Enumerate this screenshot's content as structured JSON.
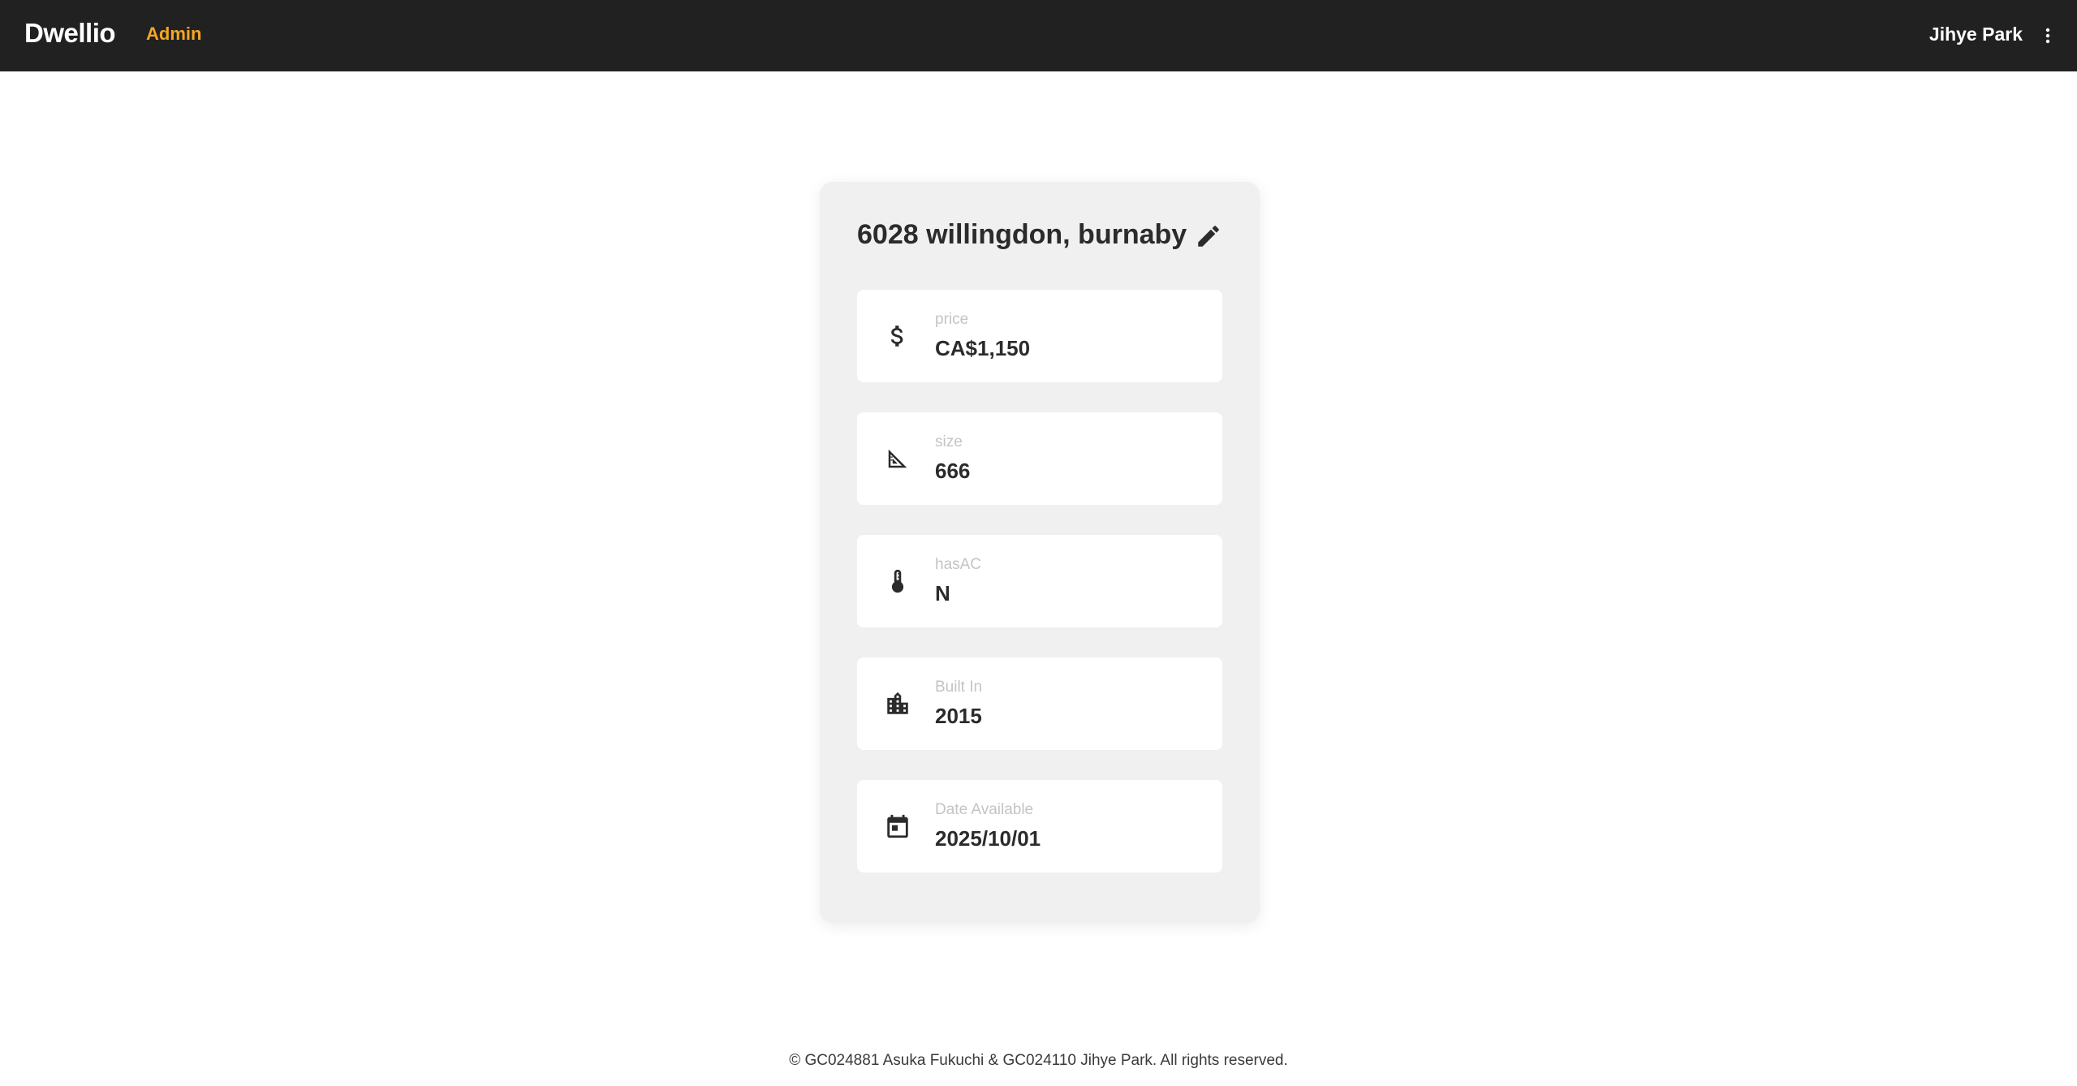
{
  "header": {
    "brand": "Dwellio",
    "role_link": "Admin",
    "user_name": "Jihye Park",
    "menu_icon": "more-vert-icon"
  },
  "listing": {
    "title": "6028 willingdon, burnaby",
    "edit_icon": "pencil-icon",
    "fields": [
      {
        "icon": "dollar-icon",
        "label": "price",
        "value": "CA$1,150"
      },
      {
        "icon": "set-square-icon",
        "label": "size",
        "value": "666"
      },
      {
        "icon": "thermometer-icon",
        "label": "hasAC",
        "value": "N"
      },
      {
        "icon": "building-icon",
        "label": "Built In",
        "value": "2015"
      },
      {
        "icon": "calendar-icon",
        "label": "Date Available",
        "value": "2025/10/01"
      }
    ]
  },
  "footer": {
    "text": "© GC024881 Asuka Fukuchi & GC024110 Jihye Park. All rights reserved."
  },
  "colors": {
    "topbar": "#212121",
    "accent": "#f5a623",
    "card_bg": "#f0f0f0",
    "text": "#2b2b2b",
    "label": "#c4c4c4"
  }
}
